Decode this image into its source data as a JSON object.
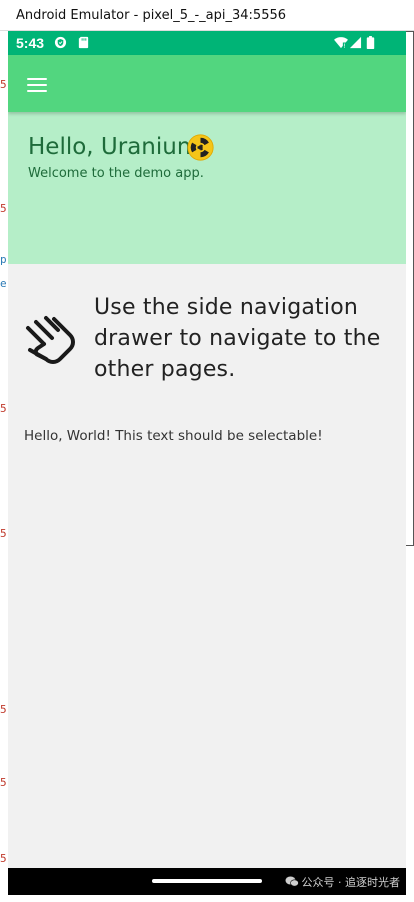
{
  "window": {
    "title": "Android Emulator - pixel_5_-_api_34:5556"
  },
  "status_bar": {
    "time": "5:43",
    "background": "#00b476",
    "icons": [
      "shield-notification-icon",
      "sd-card-icon",
      "wifi-icon",
      "cell-signal-icon",
      "battery-icon"
    ]
  },
  "app_bar": {
    "background": "#52d67f",
    "menu_icon": "hamburger-menu-icon"
  },
  "hero": {
    "title": "Hello, Uranium!",
    "title_icon": "radiation-icon",
    "subtitle": "Welcome to the demo app.",
    "background": "#b5eec8"
  },
  "content": {
    "instruction": "Use the side navigation drawer to navigate to the other pages.",
    "instruction_icon": "swipe-hand-icon",
    "selectable_text": "Hello, World! This text should be selectable!"
  },
  "nav_bar": {
    "watermark": "公众号 · 追逐时光者"
  },
  "editor_gutter": {
    "glyphs": [
      "5,",
      "5,",
      "p",
      "e",
      "5,",
      "5,",
      "5,",
      "5,",
      "5,"
    ]
  }
}
